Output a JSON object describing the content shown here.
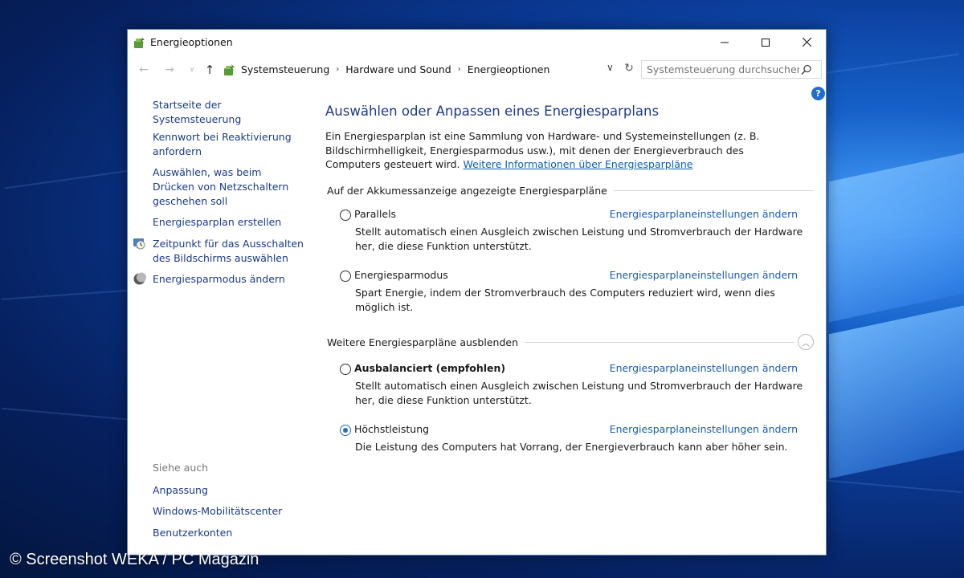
{
  "window": {
    "title": "Energieoptionen",
    "controls": {
      "minimize": "—",
      "maximize": "☐",
      "close": "✕"
    }
  },
  "nav": {
    "back": "←",
    "forward": "→",
    "recent": "∨",
    "up": "↑"
  },
  "address": {
    "crumbs": [
      "Systemsteuerung",
      "Hardware und Sound",
      "Energieoptionen"
    ],
    "separator": "›",
    "dropdown": "∨",
    "refresh": "↻"
  },
  "search": {
    "placeholder": "Systemsteuerung durchsuchen",
    "value": ""
  },
  "help": {
    "label": "?"
  },
  "sidebar": {
    "home": "Startseite der Systemsteuerung",
    "links": [
      {
        "label": "Kennwort bei Reaktivierung anfordern"
      },
      {
        "label": "Auswählen, was beim Drücken von Netzschaltern geschehen soll"
      },
      {
        "label": "Energiesparplan erstellen"
      },
      {
        "label": "Zeitpunkt für das Ausschalten des Bildschirms auswählen",
        "icon": "monitor-clock-icon"
      },
      {
        "label": "Energiesparmodus ändern",
        "icon": "moon-icon"
      }
    ],
    "see_also": {
      "heading": "Siehe auch",
      "links": [
        "Anpassung",
        "Windows-Mobilitätscenter",
        "Benutzerkonten"
      ]
    }
  },
  "main": {
    "heading": "Auswählen oder Anpassen eines Energiesparplans",
    "intro": "Ein Energiesparplan ist eine Sammlung von Hardware- und Systemeinstellungen (z. B. Bildschirmhelligkeit, Energiesparmodus usw.), mit denen der Energieverbrauch des Computers gesteuert wird.",
    "intro_link": "Weitere Informationen über Energiesparpläne",
    "section_battery": "Auf der Akkumessanzeige angezeigte Energiesparpläne",
    "section_more": "Weitere Energiesparpläne ausblenden",
    "collapse_glyph": "︿",
    "settings_link": "Energiesparplaneinstellungen ändern",
    "plans": [
      {
        "name": "Parallels",
        "desc": "Stellt automatisch einen Ausgleich zwischen Leistung und Stromverbrauch der Hardware her, die diese Funktion unterstützt.",
        "selected": false,
        "bold": false
      },
      {
        "name": "Energiesparmodus",
        "desc": "Spart Energie, indem der Stromverbrauch des Computers reduziert wird, wenn dies möglich ist.",
        "selected": false,
        "bold": false
      },
      {
        "name": "Ausbalanciert (empfohlen)",
        "desc": "Stellt automatisch einen Ausgleich zwischen Leistung und Stromverbrauch der Hardware her, die diese Funktion unterstützt.",
        "selected": false,
        "bold": true
      },
      {
        "name": "Höchstleistung",
        "desc": "Die Leistung des Computers hat Vorrang, der Energieverbrauch kann aber höher sein.",
        "selected": true,
        "bold": false
      }
    ]
  },
  "watermark": "© Screenshot WEKA / PC Magazin",
  "colors": {
    "accent": "#1e6fd0",
    "link": "#1a5eb0",
    "heading": "#1e3a8c",
    "sidebar_link": "#1a3a8a"
  }
}
